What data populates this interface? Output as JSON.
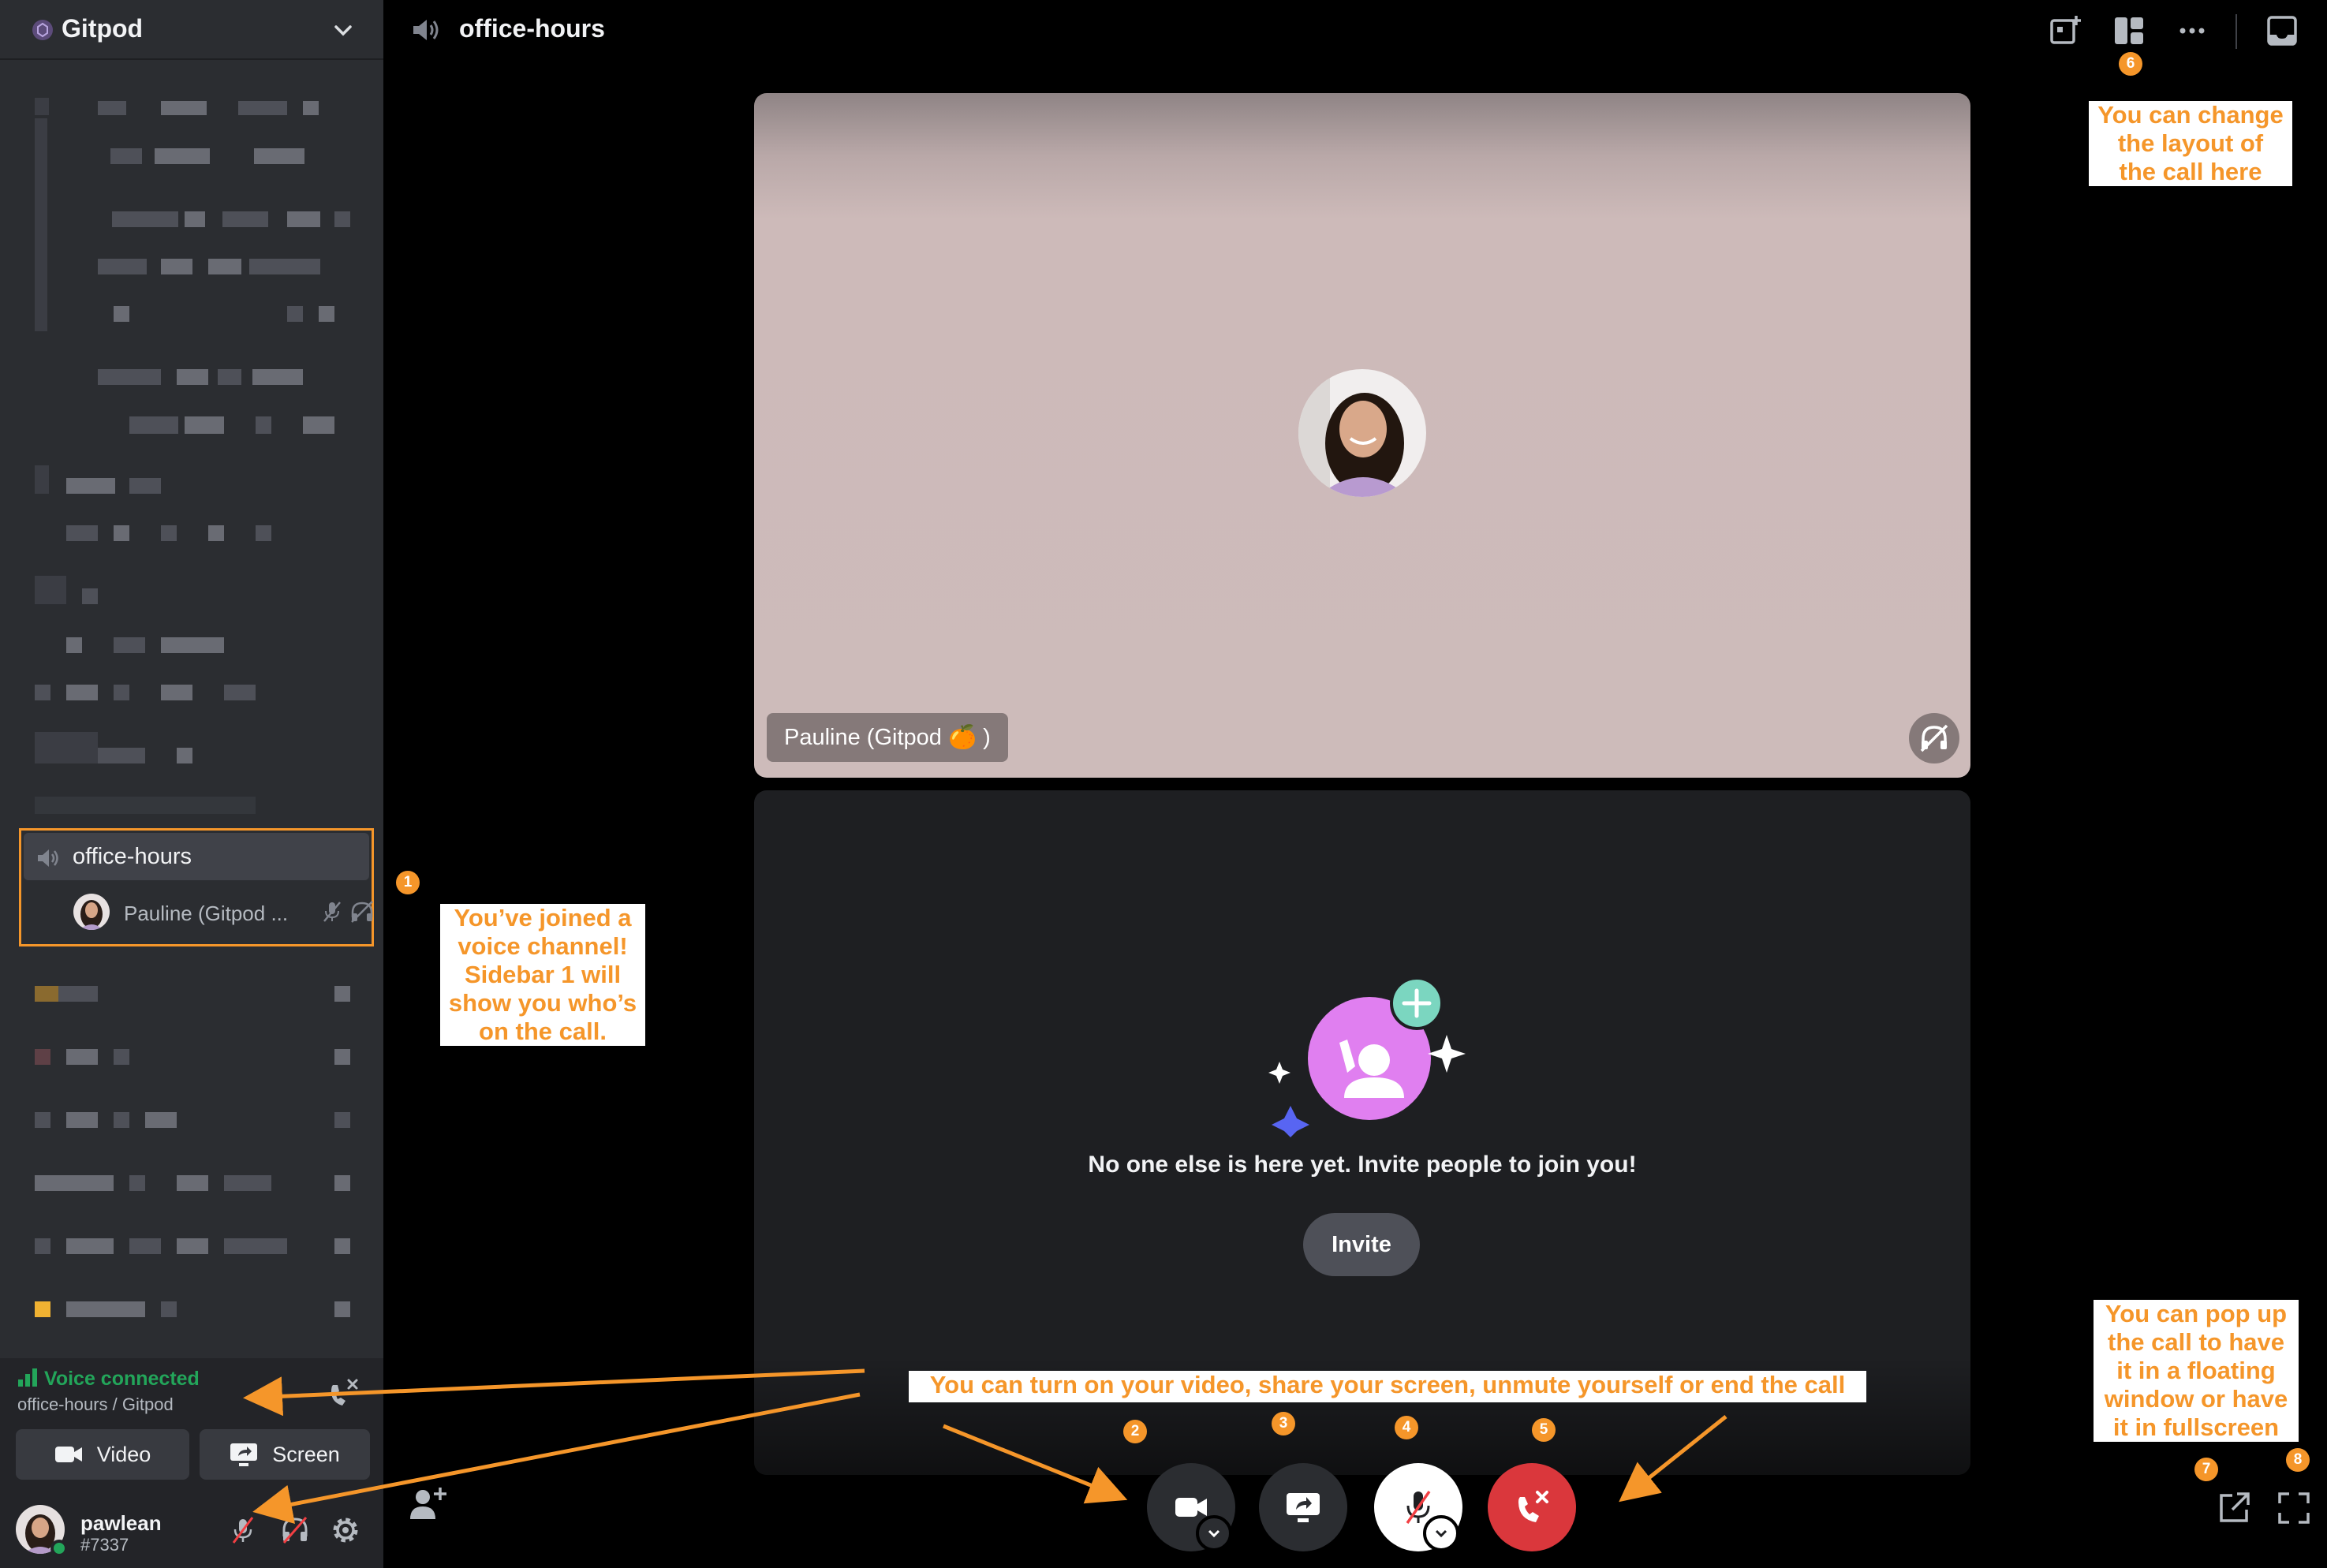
{
  "server": {
    "name": "Gitpod"
  },
  "channel": {
    "name": "office-hours",
    "user_display": "Pauline (Gitpod ...",
    "tile_name": "Pauline (Gitpod 🍊 )"
  },
  "voice": {
    "status": "Voice connected",
    "location": "office-hours / Gitpod",
    "video_label": "Video",
    "screen_label": "Screen"
  },
  "user": {
    "name": "pawlean",
    "tag": "#7337"
  },
  "empty_state": {
    "message": "No one else is here yet. Invite people to join you!",
    "invite_label": "Invite"
  },
  "annotations": {
    "sidebar_note": [
      "You’ve joined a",
      "voice channel!",
      "Sidebar 1 will",
      "show you who’s",
      "on the call."
    ],
    "controls_note": "You can turn on your video, share your screen, unmute yourself or end the call",
    "layout_note": [
      "You can change",
      "the layout of",
      "the call here"
    ],
    "popout_note": [
      "You can pop up",
      "the call to have",
      "it in a floating",
      "window or have",
      "it in fullscreen"
    ],
    "badges": [
      "1",
      "2",
      "3",
      "4",
      "5",
      "6",
      "7",
      "8"
    ]
  },
  "colors": {
    "annotation": "#f5962a",
    "connected": "#23a55a",
    "end_call": "#da373c",
    "invite_purple": "#e07ff0",
    "invite_plus": "#7bd6c0"
  },
  "icons": [
    "gitpod-logo-icon",
    "chevron-down-icon",
    "speaker-icon",
    "mic-muted-icon",
    "headphones-muted-icon",
    "signal-bars-icon",
    "disconnect-icon",
    "camera-icon",
    "screen-share-icon",
    "gear-icon",
    "add-user-icon",
    "add-activity-icon",
    "grid-layout-icon",
    "more-icon",
    "inbox-icon",
    "end-call-icon",
    "popout-icon",
    "fullscreen-icon"
  ]
}
